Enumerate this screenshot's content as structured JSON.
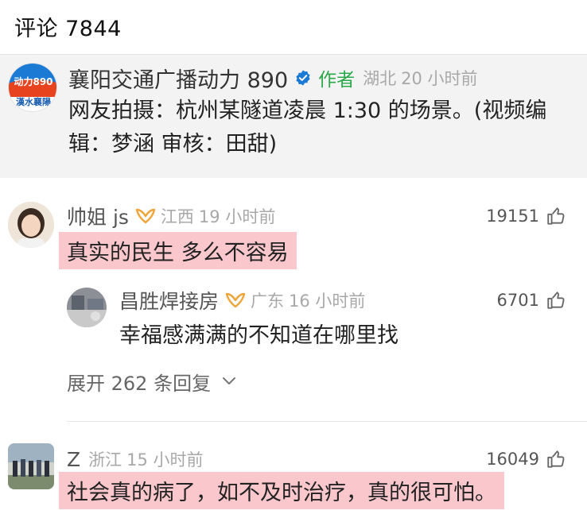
{
  "header": {
    "title": "评论 7844"
  },
  "author_post": {
    "logo_number": "动力890",
    "logo_sub": "漢水襄陽",
    "name": "襄阳交通广播动力 890",
    "tag": "作者",
    "location": "湖北",
    "time": "20 小时前",
    "text": "网友拍摄：杭州某隧道凌晨 1:30 的场景。(视频编辑：梦涵 审核：田甜)"
  },
  "comments": [
    {
      "name": "帅姐 js",
      "location": "江西",
      "time": "19 小时前",
      "likes": "19151",
      "text": "真实的民生 多么不容易",
      "reply": {
        "name": "昌胜焊接房",
        "location": "广东",
        "time": "16 小时前",
        "likes": "6701",
        "text": "幸福感满满的不知道在哪里找"
      },
      "expand_label": "展开 262 条回复"
    },
    {
      "name": "Z",
      "location": "浙江",
      "time": "15 小时前",
      "likes": "16049",
      "text": "社会真的病了，如不及时治疗，真的很可怕。"
    }
  ],
  "colors": {
    "highlight": "#f9c7cc",
    "author_tag": "#2aa84a",
    "verified": "#1b7bd4",
    "badge": "#f0a53a"
  }
}
